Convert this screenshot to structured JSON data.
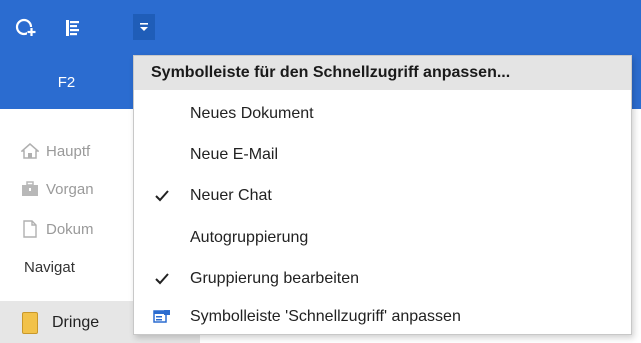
{
  "ribbon": {
    "tab_label": "F2"
  },
  "qat": {
    "icons": [
      "new-item-icon",
      "group-icon",
      "dropdown-arrow-icon"
    ]
  },
  "nav": {
    "items": [
      {
        "label": "Hauptf",
        "icon": "home-icon"
      },
      {
        "label": "Vorgan",
        "icon": "briefcase-icon"
      },
      {
        "label": "Dokum",
        "icon": "document-icon"
      }
    ],
    "title": "Navigat",
    "bottom_item": {
      "label": "Dringe",
      "icon": "folder-icon"
    }
  },
  "menu": {
    "header": "Symbolleiste für den Schnellzugriff anpassen...",
    "items": [
      {
        "label": "Neues Dokument",
        "checked": false
      },
      {
        "label": "Neue E-Mail",
        "checked": false
      },
      {
        "label": "Neuer Chat",
        "checked": true
      },
      {
        "label": "Autogruppierung",
        "checked": false
      },
      {
        "label": "Gruppierung bearbeiten",
        "checked": true
      },
      {
        "label": "Symbolleiste 'Schnellzugriff' anpassen",
        "icon": "customize-toolbar-icon"
      }
    ]
  },
  "colors": {
    "accent": "#2b6cd0",
    "menu_header_bg": "#e4e4e4",
    "nav_bottom_bg": "#e6e6e6"
  }
}
